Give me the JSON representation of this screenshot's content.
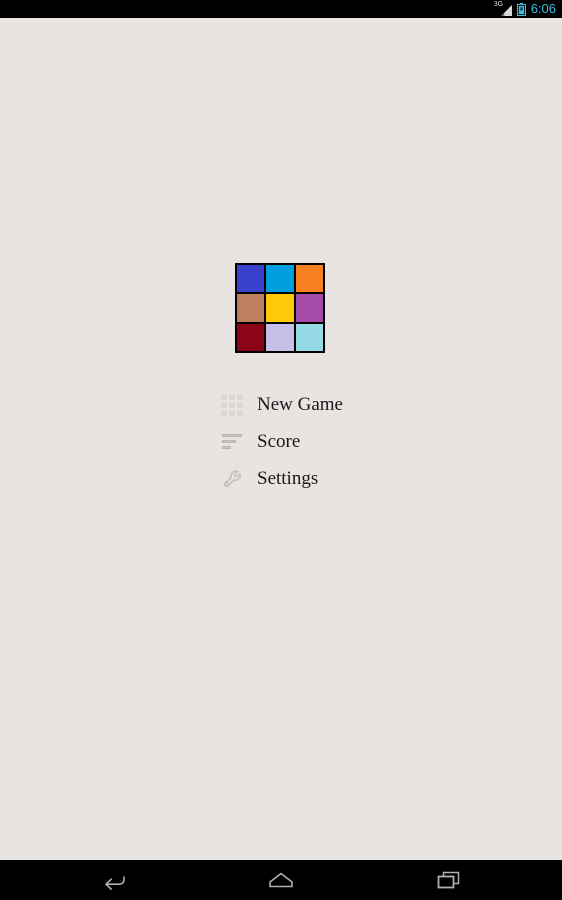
{
  "status_bar": {
    "network_label": "3G",
    "time": "6:06",
    "clock_color": "#3dbfe0",
    "battery_color": "#3dbfe0",
    "signal_icon": "signal-bars-icon",
    "battery_icon": "battery-icon",
    "background": "#000000"
  },
  "app": {
    "background": "#e8e4e2",
    "logo": {
      "name": "color-grid-logo",
      "rows": 3,
      "columns": 3,
      "border_color": "#000000",
      "cells": [
        {
          "name": "cell-1-1",
          "color": "#3a41cf"
        },
        {
          "name": "cell-1-2",
          "color": "#00a0e0"
        },
        {
          "name": "cell-1-3",
          "color": "#fb8022"
        },
        {
          "name": "cell-2-1",
          "color": "#bf7f5e"
        },
        {
          "name": "cell-2-2",
          "color": "#ffc907"
        },
        {
          "name": "cell-2-3",
          "color": "#a44aa8"
        },
        {
          "name": "cell-3-1",
          "color": "#8c0418"
        },
        {
          "name": "cell-3-2",
          "color": "#c6bee6"
        },
        {
          "name": "cell-3-3",
          "color": "#96d9e6"
        }
      ]
    },
    "menu": {
      "items": [
        {
          "label": "New Game",
          "icon": "grid-icon",
          "name": "menu-item-new-game"
        },
        {
          "label": "Score",
          "icon": "bars-icon",
          "name": "menu-item-score"
        },
        {
          "label": "Settings",
          "icon": "wrench-icon",
          "name": "menu-item-settings"
        }
      ]
    }
  },
  "nav_bar": {
    "background": "#000000",
    "buttons": [
      {
        "name": "nav-back-button",
        "icon": "back-arrow-icon"
      },
      {
        "name": "nav-home-button",
        "icon": "home-icon"
      },
      {
        "name": "nav-recents-button",
        "icon": "recent-apps-icon"
      }
    ]
  }
}
